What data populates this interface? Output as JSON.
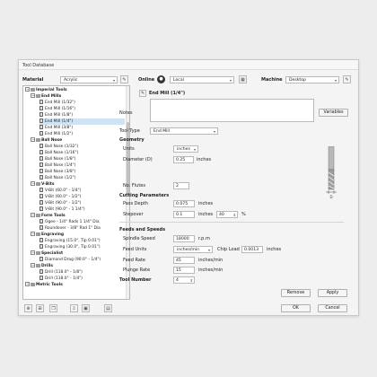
{
  "window": {
    "title": "Tool Database"
  },
  "top": {
    "material_label": "Material",
    "material_value": "Acrylic",
    "online_label": "Online",
    "online_value": "Local",
    "machine_label": "Machine",
    "machine_value": "Desktop"
  },
  "tree": {
    "items": [
      {
        "label": "Imperial Tools",
        "level": 0,
        "kind": "folder",
        "bold": true
      },
      {
        "label": "End Mills",
        "level": 1,
        "kind": "folder",
        "bold": true
      },
      {
        "label": "End Mill (1/32\")",
        "level": 2,
        "kind": "endmill"
      },
      {
        "label": "End Mill (1/16\")",
        "level": 2,
        "kind": "endmill"
      },
      {
        "label": "End Mill (1/8\")",
        "level": 2,
        "kind": "endmill"
      },
      {
        "label": "End Mill (1/4\")",
        "level": 2,
        "kind": "endmill",
        "selected": true
      },
      {
        "label": "End Mill (3/8\")",
        "level": 2,
        "kind": "endmill"
      },
      {
        "label": "End Mill (1/2\")",
        "level": 2,
        "kind": "endmill"
      },
      {
        "label": "Ball Nose",
        "level": 1,
        "kind": "folder",
        "bold": true
      },
      {
        "label": "Ball Nose (1/32\")",
        "level": 2,
        "kind": "ball"
      },
      {
        "label": "Ball Nose (1/16\")",
        "level": 2,
        "kind": "ball"
      },
      {
        "label": "Ball Nose (1/8\")",
        "level": 2,
        "kind": "ball"
      },
      {
        "label": "Ball Nose (1/4\")",
        "level": 2,
        "kind": "ball"
      },
      {
        "label": "Ball Nose (3/8\")",
        "level": 2,
        "kind": "ball"
      },
      {
        "label": "Ball Nose (1/2\")",
        "level": 2,
        "kind": "ball"
      },
      {
        "label": "V-Bits",
        "level": 1,
        "kind": "folder",
        "bold": true
      },
      {
        "label": "V-Bit (60.0° - 1/4\")",
        "level": 2,
        "kind": "vbit"
      },
      {
        "label": "V-Bit (60.0° - 1/2\")",
        "level": 2,
        "kind": "vbit"
      },
      {
        "label": "V-Bit (90.0° - 1/2\")",
        "level": 2,
        "kind": "vbit"
      },
      {
        "label": "V-Bit (90.0° - 1 1/4\")",
        "level": 2,
        "kind": "vbit"
      },
      {
        "label": "Form Tools",
        "level": 1,
        "kind": "folder",
        "bold": true
      },
      {
        "label": "Ogee - 1/4\" Rads 1 1/4\" Dia",
        "level": 2,
        "kind": "form"
      },
      {
        "label": "Roundover - 3/8\" Rad 1\" Dia",
        "level": 2,
        "kind": "form"
      },
      {
        "label": "Engraving",
        "level": 1,
        "kind": "folder",
        "bold": true
      },
      {
        "label": "Engraving (15.0°, Tip 0.01\")",
        "level": 2,
        "kind": "engrave"
      },
      {
        "label": "Engraving (30.0°, Tip 0.01\")",
        "level": 2,
        "kind": "engrave"
      },
      {
        "label": "Specialist",
        "level": 1,
        "kind": "folder",
        "bold": true
      },
      {
        "label": "Diamond Drag (90.0° - 1/4\")",
        "level": 2,
        "kind": "drag"
      },
      {
        "label": "Drills",
        "level": 1,
        "kind": "folder",
        "bold": true
      },
      {
        "label": "Drill (118.0° - 1/8\")",
        "level": 2,
        "kind": "drill"
      },
      {
        "label": "Drill (118.0° - 1/4\")",
        "level": 2,
        "kind": "drill"
      },
      {
        "label": "Metric Tools",
        "level": 0,
        "kind": "folder",
        "bold": true
      }
    ]
  },
  "detail": {
    "tool_title": "End Mill (1/4\")",
    "notes_label": "Notes",
    "variables_label": "Variables",
    "tool_type_label": "Tool Type",
    "tool_type_value": "End Mill",
    "geometry_heading": "Geometry",
    "units_label": "Units",
    "units_value": "inches",
    "diameter_label": "Diameter (D)",
    "diameter_value": "0.25",
    "diameter_unit": "inches",
    "flutes_label": "No. Flutes",
    "flutes_value": "2",
    "cutting_heading": "Cutting Parameters",
    "pass_depth_label": "Pass Depth",
    "pass_depth_value": "0.075",
    "pass_depth_unit": "inches",
    "stepover_label": "Stepover",
    "stepover_value": "0.1",
    "stepover_unit": "inches",
    "stepover_pct": "40",
    "pct_sign": "%",
    "feeds_heading": "Feeds and Speeds",
    "spindle_label": "Spindle Speed",
    "spindle_value": "18000",
    "spindle_unit": "r.p.m",
    "feed_units_label": "Feed Units",
    "feed_units_value": "inches/min",
    "chip_load_label": "Chip Load",
    "chip_load_value": "0.0013",
    "chip_load_unit": "inches",
    "feed_rate_label": "Feed Rate",
    "feed_rate_value": "45",
    "feed_rate_unit": "inches/min",
    "plunge_label": "Plunge Rate",
    "plunge_value": "15",
    "plunge_unit": "inches/min",
    "tool_number_label": "Tool Number",
    "tool_number_value": "4"
  },
  "buttons": {
    "remove": "Remove",
    "apply": "Apply",
    "ok": "OK",
    "cancel": "Cancel"
  }
}
